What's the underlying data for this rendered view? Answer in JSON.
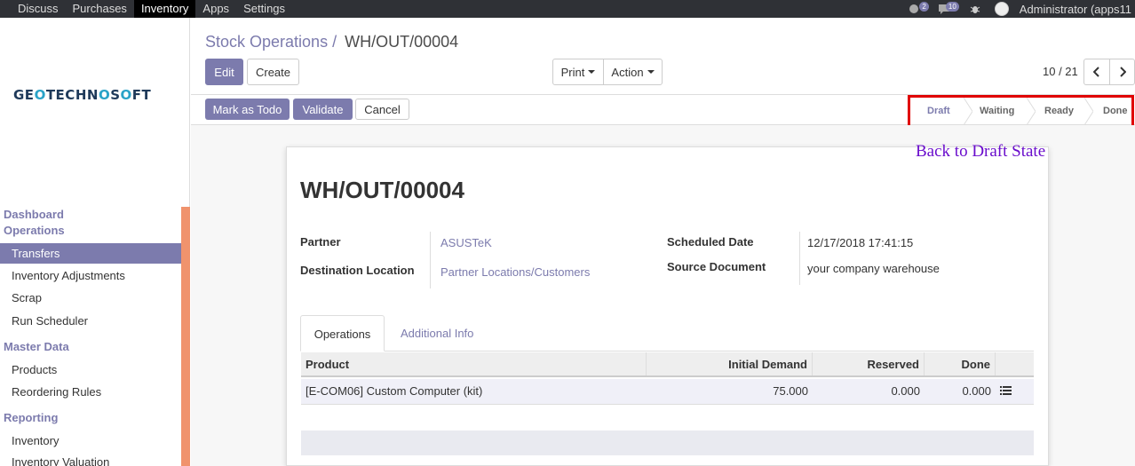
{
  "topbar": {
    "menu": [
      "Discuss",
      "Purchases",
      "Inventory",
      "Apps",
      "Settings"
    ],
    "active_menu": "Inventory",
    "chat_badge": "2",
    "messages_badge": "10",
    "user": "Administrator (apps11"
  },
  "sidebar": {
    "logo_parts": [
      "GE",
      "O",
      "TECHN",
      "O",
      "S",
      "O",
      "FT"
    ],
    "sections": [
      {
        "title": "Dashboard",
        "items": []
      },
      {
        "title": "Operations",
        "items": [
          "Transfers",
          "Inventory Adjustments",
          "Scrap",
          "Run Scheduler"
        ]
      },
      {
        "title": "Master Data",
        "items": [
          "Products",
          "Reordering Rules"
        ]
      },
      {
        "title": "Reporting",
        "items": [
          "Inventory",
          "Inventory Valuation"
        ]
      }
    ],
    "active_item": "Transfers"
  },
  "breadcrumb": {
    "parent": "Stock Operations /",
    "current": "WH/OUT/00004"
  },
  "buttons": {
    "edit": "Edit",
    "create": "Create",
    "print": "Print",
    "action": "Action"
  },
  "pager": {
    "value": "10 / 21"
  },
  "status_buttons": {
    "mark_todo": "Mark as Todo",
    "validate": "Validate",
    "cancel": "Cancel"
  },
  "stages": [
    "Draft",
    "Waiting",
    "Ready",
    "Done"
  ],
  "current_stage": "Draft",
  "annotation": "Back to Draft State",
  "form": {
    "title": "WH/OUT/00004",
    "partner_label": "Partner",
    "partner": "ASUSTeK",
    "dest_label": "Destination Location",
    "dest": "Partner Locations/Customers",
    "sched_label": "Scheduled Date",
    "sched": "12/17/2018 17:41:15",
    "source_label": "Source Document",
    "source": "your company warehouse"
  },
  "tabs": [
    "Operations",
    "Additional Info"
  ],
  "table": {
    "headers": [
      "Product",
      "Initial Demand",
      "Reserved",
      "Done"
    ],
    "rows": [
      {
        "product": "[E-COM06] Custom Computer (kit)",
        "demand": "75.000",
        "reserved": "0.000",
        "done": "0.000"
      }
    ]
  },
  "colors": {
    "accent": "#7c7bad",
    "topbar": "#2f3136",
    "highlight": "#e00000",
    "annotation": "#6a0dcc"
  }
}
